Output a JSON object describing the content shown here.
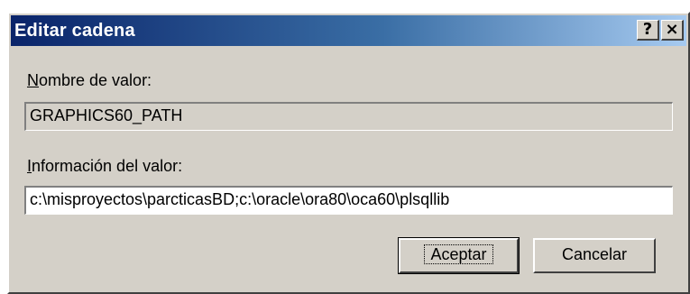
{
  "dialog": {
    "title": "Editar cadena",
    "help_button": "?",
    "close_button": "×"
  },
  "value_name": {
    "label_hotkey": "N",
    "label_rest": "ombre de valor:",
    "value": "GRAPHICS60_PATH"
  },
  "value_data": {
    "label_hotkey": "I",
    "label_rest": "nformación del valor:",
    "value": "c:\\misproyectos\\parcticasBD;c:\\oracle\\ora80\\oca60\\plsqllib"
  },
  "buttons": {
    "ok_label": "Aceptar",
    "cancel_label": "Cancelar"
  }
}
